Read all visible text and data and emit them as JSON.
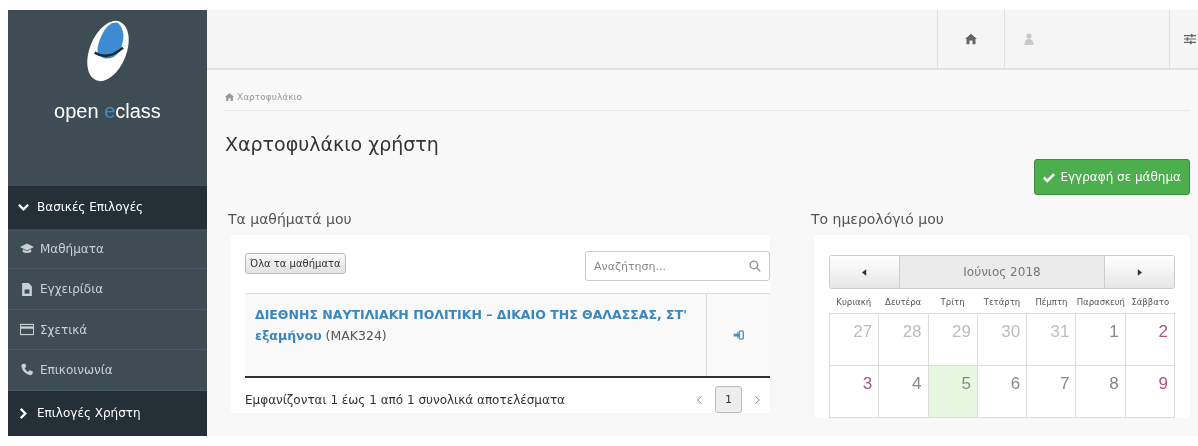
{
  "sidebar": {
    "logo": {
      "before": "open ",
      "accent": "e",
      "after": "class"
    },
    "sections": [
      {
        "label": "Βασικές Επιλογές",
        "expanded": true,
        "items": [
          {
            "label": "Μαθήματα"
          },
          {
            "label": "Εγχειρίδια"
          },
          {
            "label": "Σχετικά"
          },
          {
            "label": "Επικοινωνία"
          }
        ]
      },
      {
        "label": "Επιλογές Χρήστη",
        "expanded": false
      }
    ]
  },
  "breadcrumb": "Χαρτοφυλάκιο",
  "title": "Χαρτοφυλάκιο χρήστη",
  "register_button": "Εγγραφή σε μάθημα",
  "courses": {
    "heading": "Τα μαθήματά μου",
    "all_button": "Όλα τα μαθήματα",
    "search": {
      "placeholder": "Αναζήτηση..."
    },
    "rows": [
      {
        "title": "ΔΙΕΘΝΗΣ ΝΑΥΤΙΛΙΑΚΗ ΠΟΛΙΤΙΚΗ – ΔΙΚΑΙΟ ΤΗΣ ΘΑΛΑΣΣΑΣ, ΣΤ' εξαμήνου",
        "code": "(ΜΑΚ324)"
      }
    ],
    "footer": "Εμφανίζονται 1 έως 1 από 1 συνολικά αποτελέσματα",
    "pages": [
      {
        "label": "1",
        "selected": true
      }
    ]
  },
  "calendar": {
    "heading": "Το ημερολόγιό μου",
    "month": "Ιούνιος 2018",
    "weekdays": [
      "Κυριακή",
      "Δευτέρα",
      "Τρίτη",
      "Τετάρτη",
      "Πέμπτη",
      "Παρασκευή",
      "Σάββατο"
    ],
    "weeks": [
      [
        {
          "day": "27",
          "kind": "outside",
          "today": false
        },
        {
          "day": "28",
          "kind": "outside",
          "today": false
        },
        {
          "day": "29",
          "kind": "outside",
          "today": false
        },
        {
          "day": "30",
          "kind": "outside",
          "today": false
        },
        {
          "day": "31",
          "kind": "outside",
          "today": false
        },
        {
          "day": "1",
          "kind": "weekday",
          "today": false
        },
        {
          "day": "2",
          "kind": "weekend",
          "today": false
        }
      ],
      [
        {
          "day": "3",
          "kind": "weekend",
          "today": false
        },
        {
          "day": "4",
          "kind": "weekday",
          "today": false
        },
        {
          "day": "5",
          "kind": "weekday",
          "today": true
        },
        {
          "day": "6",
          "kind": "weekday",
          "today": false
        },
        {
          "day": "7",
          "kind": "weekday",
          "today": false
        },
        {
          "day": "8",
          "kind": "weekday",
          "today": false
        },
        {
          "day": "9",
          "kind": "weekend",
          "today": false
        }
      ]
    ]
  }
}
